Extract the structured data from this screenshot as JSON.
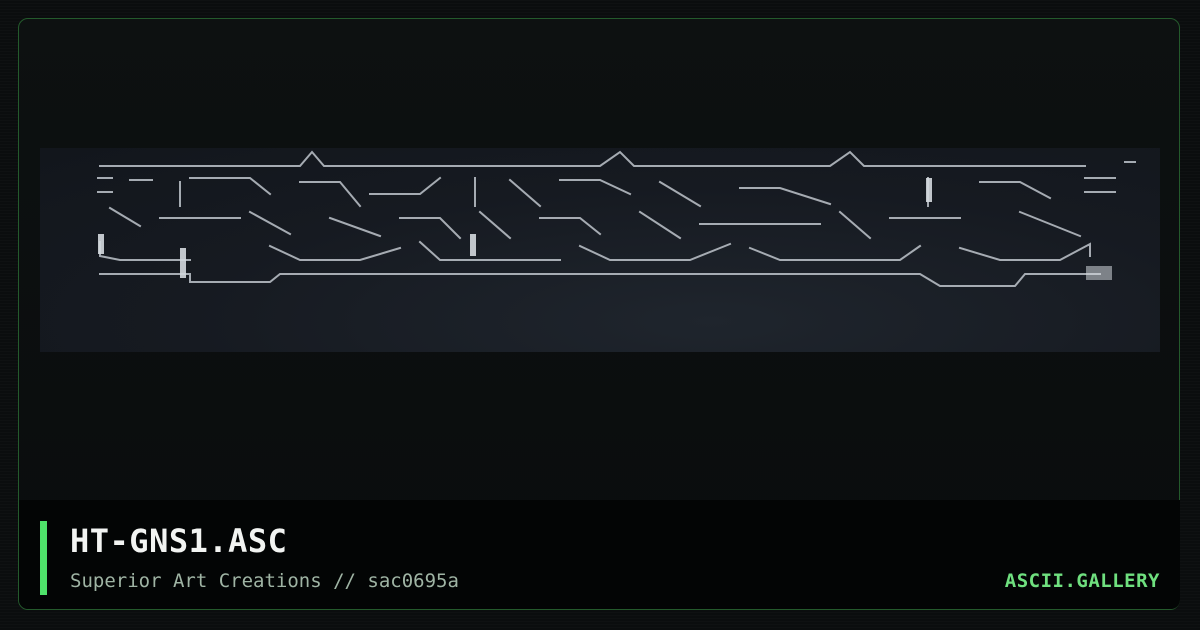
{
  "artwork": {
    "name": "ascii-art-preview"
  },
  "card": {
    "title": "HT-GNS1.ASC",
    "subtitle": "Superior Art Creations // sac0695a",
    "brand": "ASCII.GALLERY"
  },
  "colors": {
    "accent": "#4ee26a",
    "brand": "#6fe07f",
    "frame_border": "#245a2c",
    "art_stroke": "#bfc5cc"
  }
}
